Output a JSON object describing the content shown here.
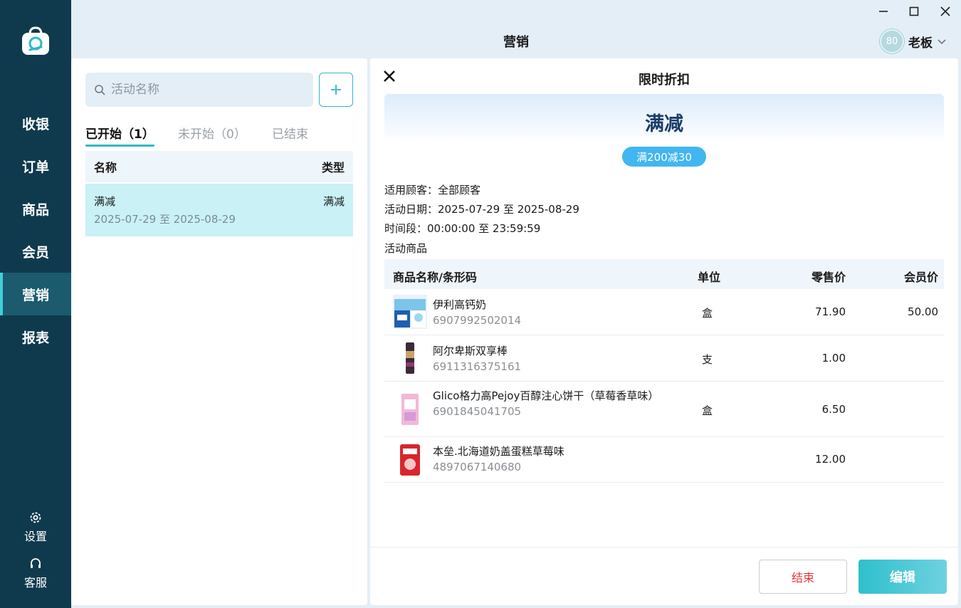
{
  "sidebar": {
    "nav": [
      {
        "label": "收银",
        "active": false
      },
      {
        "label": "订单",
        "active": false
      },
      {
        "label": "商品",
        "active": false
      },
      {
        "label": "会员",
        "active": false
      },
      {
        "label": "营销",
        "active": true
      },
      {
        "label": "报表",
        "active": false
      }
    ],
    "settings_label": "设置",
    "service_label": "客服"
  },
  "header": {
    "title": "营销",
    "avatar_text": "80",
    "user_name": "老板"
  },
  "left": {
    "search_placeholder": "活动名称",
    "tabs": [
      {
        "label": "已开始（1）",
        "active": true
      },
      {
        "label": "未开始（0）",
        "active": false
      },
      {
        "label": "已结束",
        "active": false
      }
    ],
    "columns": {
      "name": "名称",
      "type": "类型"
    },
    "rows": [
      {
        "name": "满减",
        "type": "满减",
        "date_range": "2025-07-29 至 2025-08-29"
      }
    ]
  },
  "detail": {
    "title": "限时折扣",
    "banner_title": "满减",
    "rule": "满200减30",
    "customers": "适用顾客：全部顾客",
    "dates": "活动日期：2025-07-29 至 2025-08-29",
    "time": "时间段：00:00:00 至 23:59:59",
    "products_label": "活动商品",
    "columns": {
      "name": "商品名称/条形码",
      "unit": "单位",
      "retail": "零售价",
      "member": "会员价"
    },
    "products": [
      {
        "name": "伊利高钙奶",
        "barcode": "6907992502014",
        "unit": "盒",
        "retail": "71.90",
        "member": "50.00",
        "icon": "milk-box-thumbnail"
      },
      {
        "name": "阿尔卑斯双享棒",
        "barcode": "6911316375161",
        "unit": "支",
        "retail": "1.00",
        "member": "",
        "icon": "candy-stick-thumbnail"
      },
      {
        "name": "Glico格力高Pejoy百醇注心饼干（草莓香草味）",
        "barcode": "6901845041705",
        "unit": "盒",
        "retail": "6.50",
        "member": "",
        "icon": "biscuit-box-thumbnail"
      },
      {
        "name": "本垒.北海道奶盖蛋糕草莓味",
        "barcode": "4897067140680",
        "unit": "",
        "retail": "12.00",
        "member": "",
        "icon": "cake-pack-thumbnail"
      }
    ],
    "end_label": "结束",
    "edit_label": "编辑"
  }
}
